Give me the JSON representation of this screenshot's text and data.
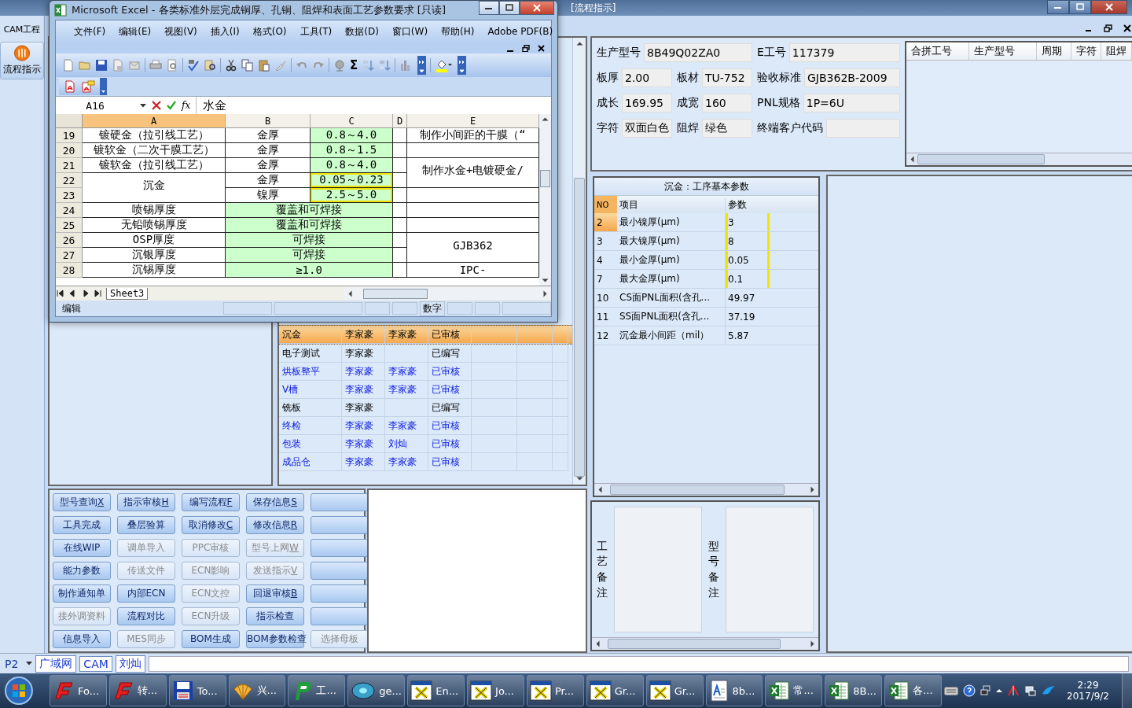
{
  "app": {
    "title": "[流程指示]",
    "side_tab": "CAM工程",
    "side_button": "流程指示"
  },
  "excel": {
    "title": "Microsoft Excel - 各类标准外层完成铜厚、孔铜、阻焊和表面工艺参数要求  [只读]",
    "menu": [
      "文件(F)",
      "编辑(E)",
      "视图(V)",
      "插入(I)",
      "格式(O)",
      "工具(T)",
      "数据(D)",
      "窗口(W)",
      "帮助(H)",
      "Adobe PDF(B)"
    ],
    "sum_symbol": "Σ",
    "name_box": "A16",
    "function_symbol": "fx",
    "formula": "水金",
    "columns": [
      {
        "label": "A",
        "selected": true
      },
      {
        "label": "B",
        "selected": false
      },
      {
        "label": "C",
        "selected": false
      },
      {
        "label": "D",
        "selected": false
      },
      {
        "label": "E",
        "selected": false
      }
    ],
    "rows": [
      {
        "num": "19",
        "cells": [
          {
            "text": "镀硬金（拉引线工艺）"
          },
          {
            "text": "金厚"
          },
          {
            "text": "0.8～4.0",
            "fill": true
          },
          {},
          {
            "text": "制作小间距的干膜（“"
          }
        ]
      },
      {
        "num": "20",
        "cells": [
          {
            "text": "镀软金（二次干膜工艺）"
          },
          {
            "text": "金厚"
          },
          {
            "text": "0.8～1.5",
            "fill": true
          },
          {},
          {}
        ]
      },
      {
        "num": "21",
        "cells": [
          {
            "text": "镀软金（拉引线工艺）"
          },
          {
            "text": "金厚"
          },
          {
            "text": "0.8～4.0",
            "fill": true
          },
          {},
          {
            "text": "制作水金+电镀硬金/",
            "merge_down": true
          }
        ]
      },
      {
        "num": "22",
        "cells": [
          {
            "text": "沉金",
            "merge_down": true
          },
          {
            "text": "金厚"
          },
          {
            "text": "0.05～0.23",
            "fill": true,
            "outlined": true
          },
          {}
        ]
      },
      {
        "num": "23",
        "cells": [
          {
            "text": "镍厚"
          },
          {
            "text": "2.5～5.0",
            "fill": true,
            "outlined": true
          },
          {},
          {}
        ]
      },
      {
        "num": "24",
        "cells": [
          {
            "text": "喷锡厚度"
          },
          {
            "text": "覆盖和可焊接",
            "fill": true,
            "merge_right": true
          },
          {},
          {}
        ]
      },
      {
        "num": "25",
        "cells": [
          {
            "text": "无铅喷锡厚度"
          },
          {
            "text": "覆盖和可焊接",
            "fill": true,
            "merge_right": true
          },
          {},
          {}
        ]
      },
      {
        "num": "26",
        "cells": [
          {
            "text": "OSP厚度"
          },
          {
            "text": "可焊接",
            "fill": true,
            "merge_right": true
          },
          {},
          {
            "text": "GJB362",
            "merge_down": true
          }
        ]
      },
      {
        "num": "27",
        "cells": [
          {
            "text": "沉银厚度"
          },
          {
            "text": "可焊接",
            "fill": true,
            "merge_right": true
          },
          {}
        ]
      },
      {
        "num": "28",
        "cells": [
          {
            "text": "沉锡厚度"
          },
          {
            "text": "≥1.0",
            "fill": true,
            "merge_right": true
          },
          {},
          {
            "text": "IPC-"
          }
        ]
      }
    ],
    "sheet_tab": "Sheet3",
    "status": "编辑",
    "status_mode": "数字"
  },
  "process": {
    "rows": [
      {
        "column_1": "沉金",
        "column_2": "李家豪",
        "column_3": "李家豪",
        "column_4": "已审核",
        "reviewed": true,
        "selected": true
      },
      {
        "column_1": "电子测试",
        "column_2": "李家豪",
        "column_4": "已编写",
        "reviewed": false,
        "selected": false
      },
      {
        "column_1": "烘板整平",
        "column_2": "李家豪",
        "column_3": "李家豪",
        "column_4": "已审核",
        "reviewed": true,
        "selected": false
      },
      {
        "column_1": "V槽",
        "column_2": "李家豪",
        "column_3": "李家豪",
        "column_4": "已审核",
        "reviewed": true,
        "selected": false
      },
      {
        "column_1": "铣板",
        "column_2": "李家豪",
        "column_4": "已编写",
        "reviewed": false,
        "selected": false
      },
      {
        "column_1": "终检",
        "column_2": "李家豪",
        "column_3": "李家豪",
        "column_4": "已审核",
        "reviewed": true,
        "selected": false
      },
      {
        "column_1": "包装",
        "column_2": "李家豪",
        "column_3": "刘灿",
        "column_4": "已审核",
        "reviewed": true,
        "selected": false
      },
      {
        "column_1": "成品仓",
        "column_2": "李家豪",
        "column_3": "李家豪",
        "column_4": "已审核",
        "reviewed": true,
        "selected": false
      }
    ]
  },
  "buttons": [
    {
      "label": "型号查询",
      "key": "X",
      "disabled": false
    },
    {
      "label": "指示审核",
      "key": "H",
      "disabled": false
    },
    {
      "label": "编写流程",
      "key": "F",
      "disabled": false
    },
    {
      "label": "保存信息",
      "key": "S",
      "disabled": false
    },
    {
      "disabled": false
    },
    {
      "label": "工具完成",
      "disabled": false
    },
    {
      "label": "叠层验算",
      "disabled": false
    },
    {
      "label": "取消修改",
      "key": "C",
      "disabled": false
    },
    {
      "label": "修改信息",
      "key": "R",
      "disabled": false
    },
    {
      "disabled": false
    },
    {
      "label": "在线WIP",
      "disabled": false
    },
    {
      "label": "调单导入",
      "disabled": true
    },
    {
      "label": "PPC审核",
      "disabled": true
    },
    {
      "label": "型号上网",
      "key": "W",
      "disabled": true
    },
    {
      "disabled": false
    },
    {
      "label": "能力参数",
      "disabled": false
    },
    {
      "label": "传送文件",
      "disabled": true
    },
    {
      "label": "ECN影响",
      "disabled": true
    },
    {
      "label": "发送指示",
      "key": "V",
      "disabled": true
    },
    {
      "disabled": false
    },
    {
      "label": "制作通知单",
      "disabled": false
    },
    {
      "label": "内部ECN",
      "disabled": false
    },
    {
      "label": "ECN文控",
      "disabled": true
    },
    {
      "label": "回退审核",
      "key": "B",
      "disabled": false
    },
    {
      "disabled": false
    },
    {
      "label": "接外调资料",
      "disabled": true
    },
    {
      "label": "流程对比",
      "disabled": false
    },
    {
      "label": "ECN升级",
      "disabled": true
    },
    {
      "label": "指示检查",
      "disabled": false
    },
    {
      "disabled": false
    },
    {
      "label": "信息导入",
      "disabled": false
    },
    {
      "label": "MES同步",
      "disabled": true
    },
    {
      "label": "BOM生成",
      "disabled": false
    },
    {
      "label": "BOM参数检查",
      "disabled": false
    },
    {
      "label": "选择母板",
      "disabled": true
    }
  ],
  "info": {
    "fields": [
      {
        "label": "生产型号",
        "value": "8B49Q02ZA0",
        "merge_right": true
      },
      {
        "label": "E工号",
        "value": "117379",
        "merge_right": false
      },
      {
        "label": "板厚",
        "value": "2.00",
        "merge_right": false
      },
      {
        "label": "板材",
        "value": "TU-752",
        "merge_right": false
      },
      {
        "label": "验收标准",
        "value": "GJB362B-2009",
        "merge_right": false
      },
      {
        "label": "成长",
        "value": "169.95",
        "merge_right": false
      },
      {
        "label": "成宽",
        "value": "160",
        "merge_right": false
      },
      {
        "label": "PNL规格",
        "value": "1P=6U",
        "merge_right": false
      },
      {
        "label": "字符",
        "value": "双面白色",
        "merge_right": false
      },
      {
        "label": "阻焊",
        "value": "绿色",
        "merge_right": false
      },
      {
        "label": "终端客户代码",
        "merge_right": false
      }
    ]
  },
  "merged_table": {
    "columns": [
      "合拼工号",
      "生产型号",
      "周期",
      "字符",
      "阻焊"
    ]
  },
  "params": {
    "title": "沉金：工序基本参数",
    "columns": [
      "NO",
      "项目",
      "参数"
    ],
    "rows": [
      {
        "no": "2",
        "item": "最小镍厚(μm)",
        "value": "3",
        "outlined": true,
        "selected": true
      },
      {
        "no": "3",
        "item": "最大镍厚(μm)",
        "value": "8",
        "outlined": true,
        "selected": false
      },
      {
        "no": "4",
        "item": "最小金厚(μm)",
        "value": "0.05",
        "outlined": true,
        "selected": false
      },
      {
        "no": "7",
        "item": "最大金厚(μm)",
        "value": "0.1",
        "outlined": true,
        "selected": false
      },
      {
        "no": "10",
        "item": "CS面PNL面积(含孔...",
        "value": "49.97",
        "outlined": false,
        "selected": false
      },
      {
        "no": "11",
        "item": "SS面PNL面积(含孔...",
        "value": "37.19",
        "outlined": false,
        "selected": false
      },
      {
        "no": "12",
        "item": "沉金最小间距（mil）",
        "value": "5.87",
        "outlined": false,
        "selected": false
      }
    ]
  },
  "remarks": [
    "工艺备注",
    "型号备注"
  ],
  "status_bar": {
    "page": "P2",
    "tabs": [
      "广域网",
      "CAM",
      "刘灿"
    ]
  },
  "taskbar": {
    "items": [
      {
        "label": "Fo...",
        "kind": "logo"
      },
      {
        "label": "转...",
        "kind": "logo"
      },
      {
        "label": "To...",
        "kind": "disk"
      },
      {
        "label": "兴...",
        "kind": "shell"
      },
      {
        "label": "工...",
        "kind": "letter"
      },
      {
        "label": "ge...",
        "kind": "disc"
      },
      {
        "label": "En...",
        "kind": "cross"
      },
      {
        "label": "Jo...",
        "kind": "cross"
      },
      {
        "label": "Pr...",
        "kind": "cross"
      },
      {
        "label": "Gr...",
        "kind": "cross"
      },
      {
        "label": "Gr...",
        "kind": "cross"
      },
      {
        "label": "8b...",
        "kind": "doc"
      },
      {
        "label": "常...",
        "kind": "sheet"
      },
      {
        "label": "8B...",
        "kind": "sheet"
      },
      {
        "label": "各...",
        "kind": "sheet"
      }
    ],
    "time": "2:29",
    "date": "2017/9/2"
  }
}
